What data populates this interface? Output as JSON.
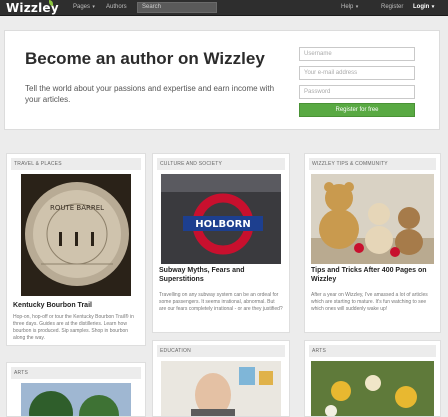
{
  "nav": {
    "logo": "Wizzley",
    "pages": "Pages",
    "authors": "Authors",
    "search_placeholder": "Search",
    "help": "Help",
    "register": "Register",
    "login": "Login"
  },
  "hero": {
    "title": "Become an author on Wizzley",
    "subtitle": "Tell the world about your passions and expertise and earn income with your articles.",
    "username_placeholder": "Username",
    "email_placeholder": "Your e-mail address",
    "password_placeholder": "Password",
    "register_button": "Register for free"
  },
  "cards": [
    {
      "category": "TRAVEL & PLACES",
      "title": "Kentucky Bourbon Trail",
      "text": "Hop-on, hop-off or tour the Kentucky Bourbon Trail® in three days. Guides are at the distilleries. Learn how bourbon is produced. Sip samples. Shop in bourbon along the way."
    },
    {
      "category": "CULTURE AND SOCIETY",
      "title": "Subway Myths, Fears and Superstitions",
      "text": "Travelling on any subway system can be an ordeal for some passengers. It seems irrational, abnormal. But are our fears completely irrational - or are they justified?"
    },
    {
      "category": "WIZZLEY TIPS & COMMUNITY",
      "title": "Tips and Tricks After 400 Pages on Wizzley",
      "text": "After a year on Wizzley, I've amassed a lot of articles which are starting to mature. It's fun watching to see which ones will suddenly wake up!"
    },
    {
      "category": "ARTS"
    },
    {
      "category": "EDUCATION"
    },
    {
      "category": "ARTS"
    }
  ],
  "images": {
    "barrel_sign": "ROUTE BARREL",
    "subway_sign": "HOLBORN"
  },
  "colors": {
    "topbar": "#2e2e2e",
    "accent_green": "#59a943",
    "page_bg": "#ececec"
  }
}
